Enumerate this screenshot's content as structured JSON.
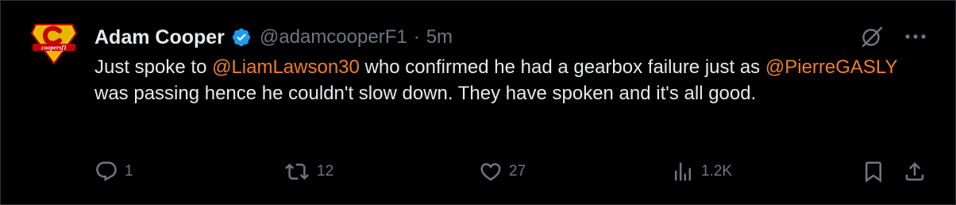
{
  "author": {
    "name": "Adam Cooper",
    "handle": "@adamcooperF1",
    "separator": "·",
    "time": "5m",
    "avatar_text": "coopersf1"
  },
  "tweet": {
    "t1": "Just spoke to ",
    "m1": "@LiamLawson30",
    "t2": " who confirmed he had a gearbox failure just as ",
    "m2": "@PierreGASLY",
    "t3": " was passing hence he couldn't slow down. They have spoken and it's all good."
  },
  "actions": {
    "reply_count": "1",
    "retweet_count": "12",
    "like_count": "27",
    "views_count": "1.2K"
  },
  "icons": {
    "reply": "reply-icon",
    "retweet": "retweet-icon",
    "like": "like-icon",
    "views": "views-icon",
    "bookmark": "bookmark-icon",
    "share": "share-icon",
    "grok": "grok-icon",
    "more": "more-icon",
    "verified": "verified-icon"
  },
  "colors": {
    "background": "#000000",
    "text": "#e7e9ea",
    "muted": "#71767b",
    "mention": "#f17d27",
    "verified": "#1d9bf0"
  }
}
